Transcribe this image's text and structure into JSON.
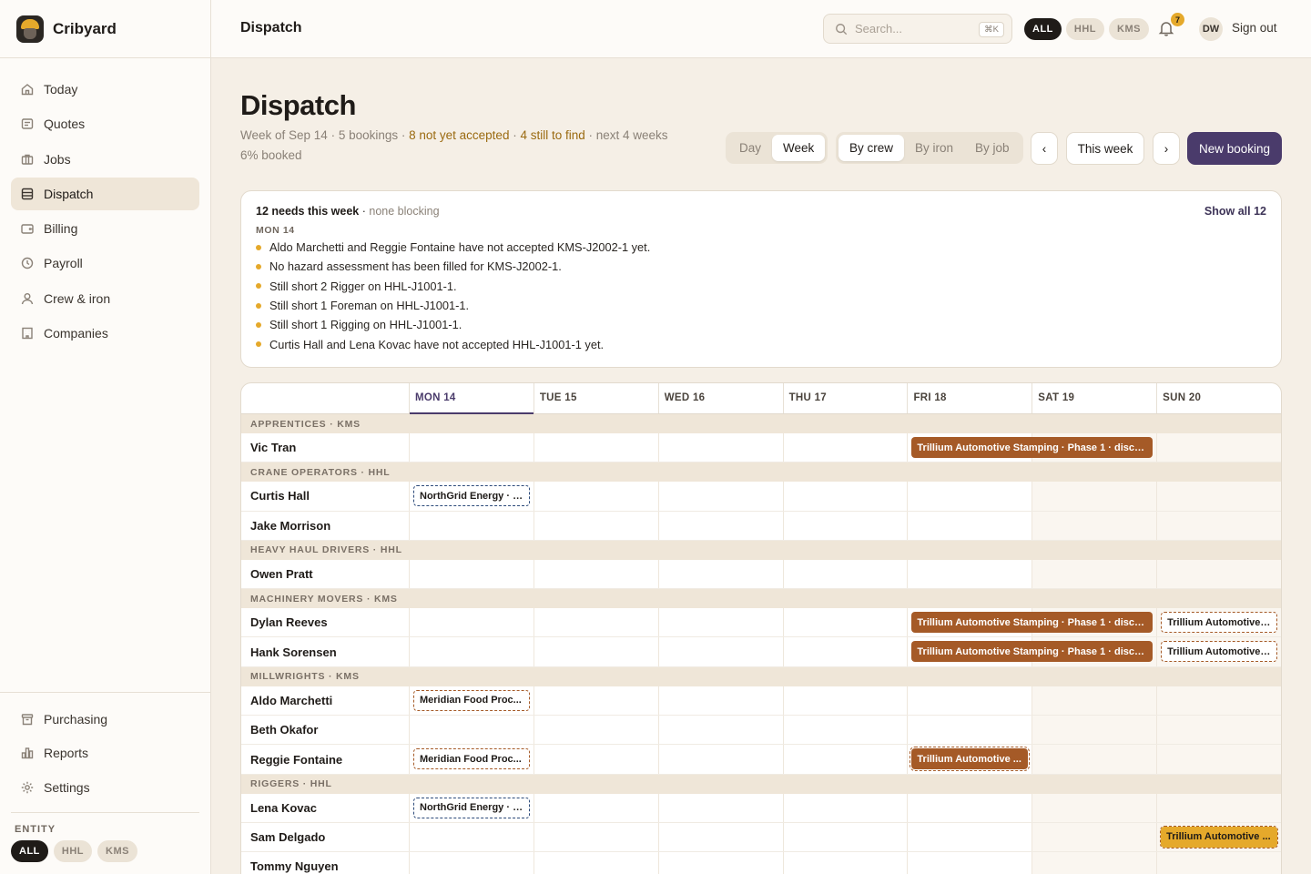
{
  "app": {
    "name": "Cribyard"
  },
  "sidebar": {
    "items": [
      {
        "label": "Today",
        "icon": "home-icon"
      },
      {
        "label": "Quotes",
        "icon": "quote-icon"
      },
      {
        "label": "Jobs",
        "icon": "jobs-icon"
      },
      {
        "label": "Dispatch",
        "icon": "dispatch-icon",
        "active": true
      },
      {
        "label": "Billing",
        "icon": "wallet-icon"
      },
      {
        "label": "Payroll",
        "icon": "clock-icon"
      },
      {
        "label": "Crew & iron",
        "icon": "user-icon"
      },
      {
        "label": "Companies",
        "icon": "building-icon"
      }
    ],
    "bottom_items": [
      {
        "label": "Purchasing",
        "icon": "box-icon"
      },
      {
        "label": "Reports",
        "icon": "chart-icon"
      },
      {
        "label": "Settings",
        "icon": "gear-icon"
      }
    ],
    "entity_label": "ENTITY",
    "entity_options": [
      "ALL",
      "HHL",
      "KMS"
    ]
  },
  "topbar": {
    "title": "Dispatch",
    "search_placeholder": "Search...",
    "search_shortcut": "⌘K",
    "entity_options": [
      "ALL",
      "HHL",
      "KMS"
    ],
    "notification_count": "7",
    "avatar_initials": "DW",
    "signout_label": "Sign out"
  },
  "header": {
    "title": "Dispatch",
    "week_of": "Week of Sep 14",
    "bookings": "5 bookings",
    "not_accepted": "8 not yet accepted",
    "still_to_find": "4 still to find",
    "booked": "next 4 weeks 6% booked",
    "view_options": [
      "Day",
      "Week"
    ],
    "group_options": [
      "By crew",
      "By iron",
      "By job"
    ],
    "prev_label": "‹",
    "this_week_label": "This week",
    "next_label": "›",
    "new_booking_label": "New booking"
  },
  "needs": {
    "count_label": "12 needs this week",
    "status": "none blocking",
    "show_all_label": "Show all 12",
    "day_label": "MON 14",
    "items": [
      "Aldo Marchetti and Reggie Fontaine have not accepted KMS-J2002-1 yet.",
      "No hazard assessment has been filled for KMS-J2002-1.",
      "Still short 2 Rigger on HHL-J1001-1.",
      "Still short 1 Foreman on HHL-J1001-1.",
      "Still short 1 Rigging on HHL-J1001-1.",
      "Curtis Hall and Lena Kovac have not accepted HHL-J1001-1 yet."
    ]
  },
  "calendar": {
    "days": [
      "MON 14",
      "TUE 15",
      "WED 16",
      "THU 17",
      "FRI 18",
      "SAT 19",
      "SUN 20"
    ],
    "groups": [
      {
        "name": "APPRENTICES · KMS",
        "crew": [
          {
            "name": "Vic Tran",
            "bookings": [
              {
                "start": 4,
                "span": 2,
                "label": "Trillium Automotive Stamping · Phase 1 · discon...",
                "style": "solid"
              }
            ]
          }
        ]
      },
      {
        "name": "CRANE OPERATORS · HHL",
        "crew": [
          {
            "name": "Curtis Hall",
            "bookings": [
              {
                "start": 0,
                "span": 1,
                "label": "NorthGrid Energy · R...",
                "style": "tent-blue"
              }
            ]
          },
          {
            "name": "Jake Morrison",
            "bookings": []
          }
        ]
      },
      {
        "name": "HEAVY HAUL DRIVERS · HHL",
        "crew": [
          {
            "name": "Owen Pratt",
            "bookings": []
          }
        ]
      },
      {
        "name": "MACHINERY MOVERS · KMS",
        "crew": [
          {
            "name": "Dylan Reeves",
            "bookings": [
              {
                "start": 4,
                "span": 2,
                "label": "Trillium Automotive Stamping · Phase 1 · discon...",
                "style": "solid"
              },
              {
                "start": 6,
                "span": 1,
                "label": "Trillium Automotive ...",
                "style": "tent-brown"
              }
            ]
          },
          {
            "name": "Hank Sorensen",
            "bookings": [
              {
                "start": 4,
                "span": 2,
                "label": "Trillium Automotive Stamping · Phase 1 · discon...",
                "style": "solid"
              },
              {
                "start": 6,
                "span": 1,
                "label": "Trillium Automotive ...",
                "style": "tent-brown"
              }
            ]
          }
        ]
      },
      {
        "name": "MILLWRIGHTS · KMS",
        "crew": [
          {
            "name": "Aldo Marchetti",
            "bookings": [
              {
                "start": 0,
                "span": 1,
                "label": "Meridian Food Proc...",
                "style": "tent-brown"
              }
            ]
          },
          {
            "name": "Beth Okafor",
            "bookings": []
          },
          {
            "name": "Reggie Fontaine",
            "bookings": [
              {
                "start": 0,
                "span": 1,
                "label": "Meridian Food Proc...",
                "style": "tent-brown"
              },
              {
                "start": 4,
                "span": 1,
                "label": "Trillium Automotive ...",
                "style": "solid-dashed"
              }
            ]
          }
        ]
      },
      {
        "name": "RIGGERS · HHL",
        "crew": [
          {
            "name": "Lena Kovac",
            "bookings": [
              {
                "start": 0,
                "span": 1,
                "label": "NorthGrid Energy · R...",
                "style": "tent-blue"
              }
            ]
          },
          {
            "name": "Sam Delgado",
            "bookings": [
              {
                "start": 6,
                "span": 1,
                "label": "Trillium Automotive ...",
                "style": "gold"
              }
            ]
          },
          {
            "name": "Tommy Nguyen",
            "bookings": []
          }
        ]
      }
    ]
  },
  "colors": {
    "accent": "#4a3b6b",
    "booking": "#a55a27",
    "warning": "#e5a92b",
    "tentative_blue": "#2c4a7a"
  }
}
